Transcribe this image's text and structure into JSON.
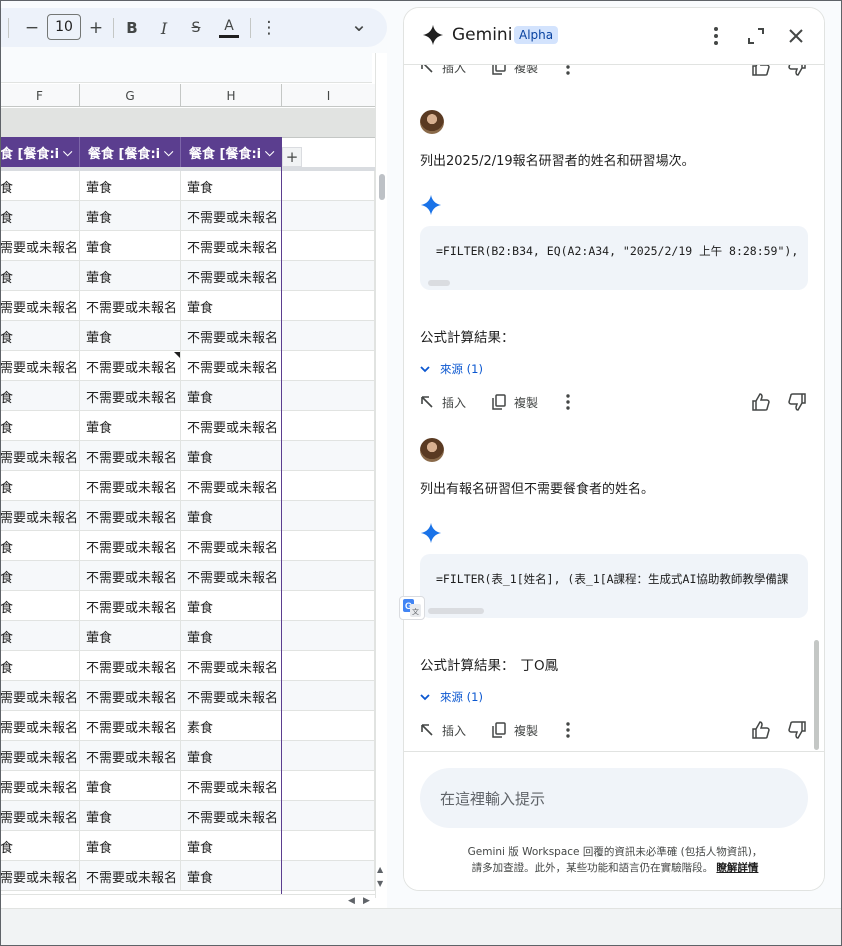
{
  "toolbar": {
    "minus": "−",
    "font_size": "10",
    "plus": "+",
    "bold": "B",
    "italic": "I",
    "strike": "S",
    "text_color": "A",
    "more": "⋮",
    "collapse": "⌄"
  },
  "sheet": {
    "columns": [
      "F",
      "G",
      "H",
      "I"
    ],
    "header_cells": [
      "食 [餐食:i",
      "餐食 [餐食:i",
      "餐食 [餐食:i"
    ],
    "add_column": "+",
    "rows": [
      [
        "食",
        "葷食",
        "葷食"
      ],
      [
        "食",
        "葷食",
        "不需要或未報名"
      ],
      [
        "需要或未報名",
        "葷食",
        "不需要或未報名"
      ],
      [
        "食",
        "葷食",
        "不需要或未報名"
      ],
      [
        "需要或未報名",
        "不需要或未報名",
        "葷食"
      ],
      [
        "食",
        "葷食",
        "不需要或未報名"
      ],
      [
        "需要或未報名",
        "不需要或未報名",
        "不需要或未報名"
      ],
      [
        "食",
        "不需要或未報名",
        "葷食"
      ],
      [
        "食",
        "葷食",
        "不需要或未報名"
      ],
      [
        "需要或未報名",
        "不需要或未報名",
        "葷食"
      ],
      [
        "食",
        "不需要或未報名",
        "不需要或未報名"
      ],
      [
        "需要或未報名",
        "不需要或未報名",
        "葷食"
      ],
      [
        "食",
        "不需要或未報名",
        "不需要或未報名"
      ],
      [
        "食",
        "不需要或未報名",
        "不需要或未報名"
      ],
      [
        "食",
        "不需要或未報名",
        "葷食"
      ],
      [
        "食",
        "葷食",
        "葷食"
      ],
      [
        "食",
        "不需要或未報名",
        "不需要或未報名"
      ],
      [
        "需要或未報名",
        "不需要或未報名",
        "不需要或未報名"
      ],
      [
        "需要或未報名",
        "不需要或未報名",
        "素食"
      ],
      [
        "需要或未報名",
        "不需要或未報名",
        "葷食"
      ],
      [
        "需要或未報名",
        "葷食",
        "不需要或未報名"
      ],
      [
        "需要或未報名",
        "葷食",
        "不需要或未報名"
      ],
      [
        "食",
        "葷食",
        "葷食"
      ],
      [
        "需要或未報名",
        "不需要或未報名",
        "葷食"
      ]
    ]
  },
  "gemini": {
    "title": "Gemini",
    "badge": "Alpha",
    "insert_label": "插入",
    "copy_label": "複製",
    "messages": [
      {
        "question": "列出2025/2/19報名研習者的姓名和研習場次。",
        "formula": "=FILTER(B2:B34, EQ(A2:A34, \"2025/2/19 上午 8:28:59\"), ",
        "result_label": "公式計算結果：",
        "result_value": "",
        "sources": "來源 (1)"
      },
      {
        "question": "列出有報名研習但不需要餐食者的姓名。",
        "formula": "=FILTER(表_1[姓名], (表_1[A課程：生成式AI協助教師教學備課",
        "result_label": "公式計算結果：",
        "result_value": "丁O鳳",
        "sources": "來源 (1)"
      }
    ],
    "prompt_placeholder": "在這裡輸入提示",
    "disclaimer_line1": "Gemini 版 Workspace 回覆的資訊未必準確 (包括人物資訊)，",
    "disclaimer_line2": "請多加查證。此外，某些功能和語言仍在實驗階段。",
    "learn_more": "瞭解詳情"
  },
  "colors": {
    "table_header": "#5b3e8f",
    "accent_blue": "#0b57d0",
    "gemini_star": "#1a73e8"
  }
}
